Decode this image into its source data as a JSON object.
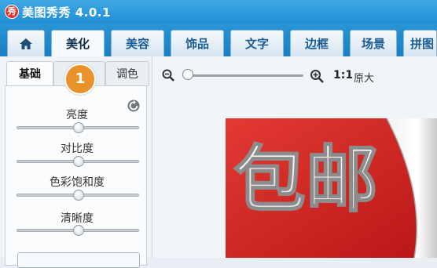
{
  "app": {
    "logo_char": "秀",
    "title": "美图秀秀 4.0.1"
  },
  "main_tabs": [
    {
      "label": "美化"
    },
    {
      "label": "美容"
    },
    {
      "label": "饰品"
    },
    {
      "label": "文字"
    },
    {
      "label": "边框"
    },
    {
      "label": "场景"
    },
    {
      "label": "拼图"
    }
  ],
  "sub_tabs": [
    {
      "label": "基础"
    },
    {
      "label": ""
    },
    {
      "label": "调色"
    }
  ],
  "step_badge": "1",
  "sliders": [
    {
      "label": "亮度",
      "value": 0.5
    },
    {
      "label": "对比度",
      "value": 0.5
    },
    {
      "label": "色彩饱和度",
      "value": 0.5
    },
    {
      "label": "清晰度",
      "value": 0.5
    }
  ],
  "zoom": {
    "actual_label": "1:1",
    "original_label": "原大",
    "level": 0.0
  },
  "photo": {
    "text": "包邮"
  },
  "icons": {
    "home": "home-icon",
    "zoom_out": "zoom-out-icon",
    "zoom_in": "zoom-in-icon",
    "reset": "reset-icon"
  },
  "colors": {
    "accent": "#1f8fd4",
    "badge": "#e8922b",
    "photo_red": "#dd2626"
  }
}
